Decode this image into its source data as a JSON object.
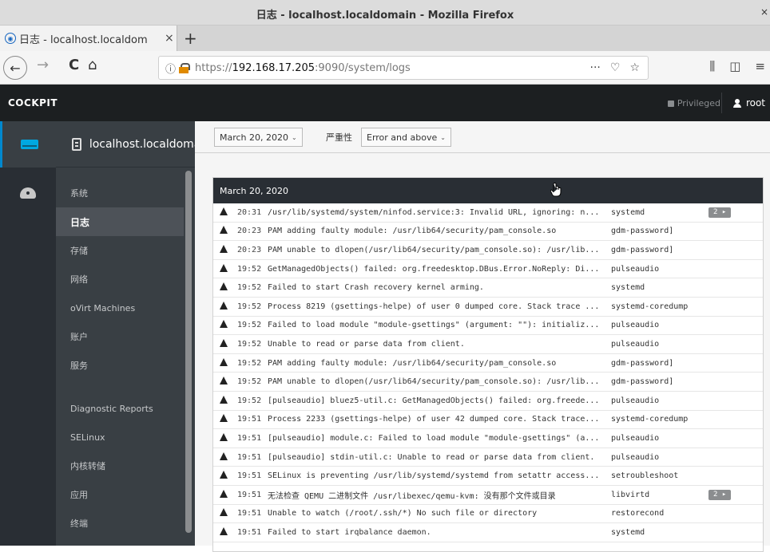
{
  "window": {
    "title": "日志 - localhost.localdomain - Mozilla Firefox",
    "close_glyph": "×"
  },
  "tab": {
    "label": "日志 - localhost.localdom",
    "close_glyph": "×",
    "new_tab_glyph": "+"
  },
  "nav": {
    "back_glyph": "←",
    "forward_glyph": "→",
    "reload_glyph": "C",
    "home_glyph": "⌂",
    "info_glyph": "ⓘ"
  },
  "url": {
    "prefix": "https://",
    "host": "192.168.17.205",
    "rest": ":9090/system/logs"
  },
  "url_icons": {
    "more": "···",
    "pocket": "♡",
    "star": "☆"
  },
  "nav_right": {
    "library": "⫼",
    "sidebar": "◫",
    "menu": "≡"
  },
  "cockpit": {
    "brand": "COCKPIT",
    "privileged": "Privileged",
    "user": "root"
  },
  "host": {
    "name": "localhost.localdomain"
  },
  "menu": [
    {
      "label": "系统",
      "active": false,
      "gap": false
    },
    {
      "label": "日志",
      "active": true,
      "gap": false
    },
    {
      "label": "存储",
      "active": false,
      "gap": false
    },
    {
      "label": "网络",
      "active": false,
      "gap": false
    },
    {
      "label": "oVirt Machines",
      "active": false,
      "gap": false
    },
    {
      "label": "账户",
      "active": false,
      "gap": false
    },
    {
      "label": "服务",
      "active": false,
      "gap": false
    },
    {
      "label": "Diagnostic Reports",
      "active": false,
      "gap": true
    },
    {
      "label": "SELinux",
      "active": false,
      "gap": false
    },
    {
      "label": "内核转储",
      "active": false,
      "gap": false
    },
    {
      "label": "应用",
      "active": false,
      "gap": false
    },
    {
      "label": "终端",
      "active": false,
      "gap": false
    }
  ],
  "filters": {
    "date": "March 20, 2020",
    "severity_label": "严重性",
    "severity": "Error and above"
  },
  "log": {
    "date_header": "March 20, 2020",
    "entries": [
      {
        "time": "20:31",
        "msg": "/usr/lib/systemd/system/ninfod.service:3: Invalid URL, ignoring: n...",
        "id": "systemd",
        "count": "2 ▸"
      },
      {
        "time": "20:23",
        "msg": "PAM adding faulty module: /usr/lib64/security/pam_console.so",
        "id": "gdm-password]",
        "count": ""
      },
      {
        "time": "20:23",
        "msg": "PAM unable to dlopen(/usr/lib64/security/pam_console.so): /usr/lib...",
        "id": "gdm-password]",
        "count": ""
      },
      {
        "time": "19:52",
        "msg": "GetManagedObjects() failed: org.freedesktop.DBus.Error.NoReply: Di...",
        "id": "pulseaudio",
        "count": ""
      },
      {
        "time": "19:52",
        "msg": "Failed to start Crash recovery kernel arming.",
        "id": "systemd",
        "count": ""
      },
      {
        "time": "19:52",
        "msg": "Process 8219 (gsettings-helpe) of user 0 dumped core. Stack trace ...",
        "id": "systemd-coredump",
        "count": ""
      },
      {
        "time": "19:52",
        "msg": "Failed to load module \"module-gsettings\" (argument: \"\"): initializ...",
        "id": "pulseaudio",
        "count": ""
      },
      {
        "time": "19:52",
        "msg": "Unable to read or parse data from client.",
        "id": "pulseaudio",
        "count": ""
      },
      {
        "time": "19:52",
        "msg": "PAM adding faulty module: /usr/lib64/security/pam_console.so",
        "id": "gdm-password]",
        "count": ""
      },
      {
        "time": "19:52",
        "msg": "PAM unable to dlopen(/usr/lib64/security/pam_console.so): /usr/lib...",
        "id": "gdm-password]",
        "count": ""
      },
      {
        "time": "19:52",
        "msg": "[pulseaudio] bluez5-util.c: GetManagedObjects() failed: org.freede...",
        "id": "pulseaudio",
        "count": ""
      },
      {
        "time": "19:51",
        "msg": "Process 2233 (gsettings-helpe) of user 42 dumped core. Stack trace...",
        "id": "systemd-coredump",
        "count": ""
      },
      {
        "time": "19:51",
        "msg": "[pulseaudio] module.c: Failed to load module \"module-gsettings\" (a...",
        "id": "pulseaudio",
        "count": ""
      },
      {
        "time": "19:51",
        "msg": "[pulseaudio] stdin-util.c: Unable to read or parse data from client.",
        "id": "pulseaudio",
        "count": ""
      },
      {
        "time": "19:51",
        "msg": "SELinux is preventing /usr/lib/systemd/systemd from setattr access...",
        "id": "setroubleshoot",
        "count": ""
      },
      {
        "time": "19:51",
        "msg": "无法检查 QEMU 二进制文件 /usr/libexec/qemu-kvm: 没有那个文件或目录",
        "id": "libvirtd",
        "count": "2 ▸"
      },
      {
        "time": "19:51",
        "msg": "Unable to watch (/root/.ssh/*) No such file or directory",
        "id": "restorecond",
        "count": ""
      },
      {
        "time": "19:51",
        "msg": "Failed to start irqbalance daemon.",
        "id": "systemd",
        "count": ""
      }
    ]
  }
}
